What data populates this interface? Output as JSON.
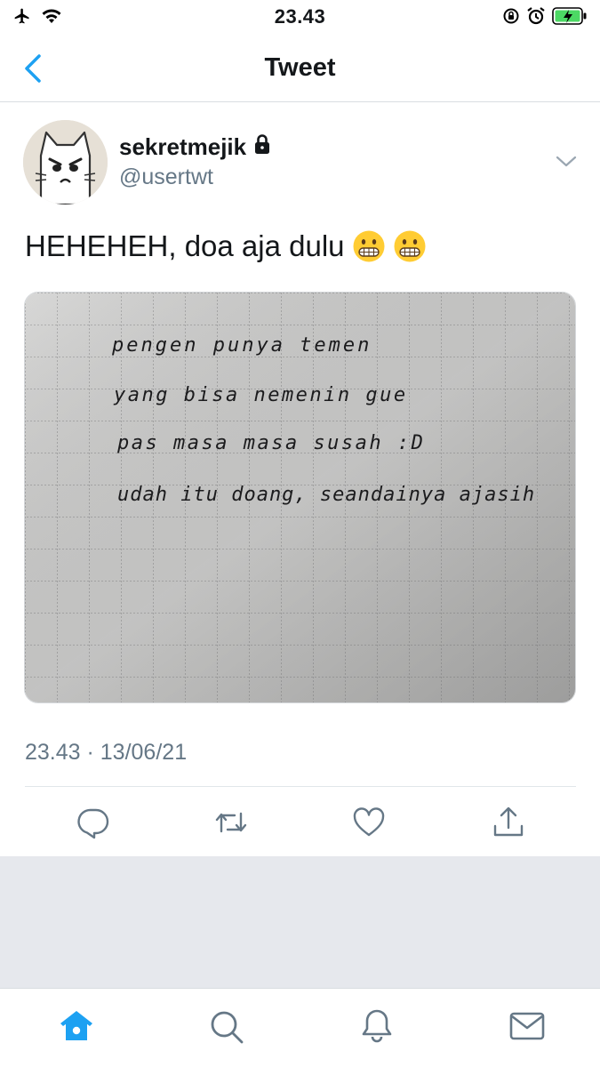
{
  "status_bar": {
    "time": "23.43",
    "left_icons": [
      "airplane-icon",
      "wifi-icon"
    ],
    "right_icons": [
      "rotation-lock-icon",
      "alarm-icon",
      "battery-charging-icon"
    ]
  },
  "nav": {
    "title": "Tweet",
    "back_icon": "chevron-left-icon"
  },
  "tweet": {
    "display_name": "sekretmejik",
    "locked_icon": "lock-icon",
    "username": "@usertwt",
    "text": "HEHEHEH, doa aja dulu",
    "emojis": [
      "grimacing-face",
      "grimacing-face"
    ],
    "media": {
      "handwritten_lines": [
        "pengen punya temen",
        "yang bisa nemenin gue",
        "pas masa masa susah :D",
        "udah itu doang, seandainya ajasih"
      ]
    },
    "timestamp": "23.43 · 13/06/21"
  },
  "actions": [
    "reply-icon",
    "retweet-icon",
    "like-icon",
    "share-icon"
  ],
  "tab_bar": [
    "home-icon",
    "search-icon",
    "notifications-icon",
    "messages-icon"
  ],
  "colors": {
    "accent": "#1da1f2",
    "text": "#14171a",
    "secondary": "#657786",
    "icon_gray": "#657786",
    "battery_green": "#4cd964"
  }
}
